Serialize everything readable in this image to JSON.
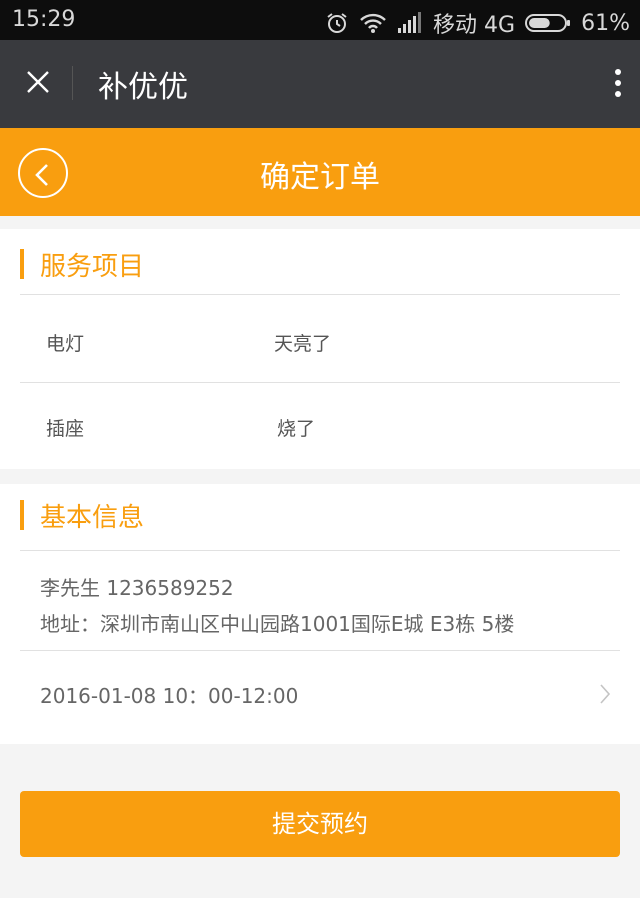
{
  "status_bar": {
    "time": "15:29",
    "carrier": "移动 4G",
    "battery": "61%",
    "battery_level": 0.61
  },
  "app_bar": {
    "title": "补优优"
  },
  "header": {
    "title": "确定订单"
  },
  "service_section": {
    "title": "服务项目",
    "items": [
      {
        "name": "电灯",
        "desc": "天亮了"
      },
      {
        "name": "插座",
        "desc": "烧了"
      }
    ]
  },
  "info_section": {
    "title": "基本信息",
    "contact": "李先生  1236589252",
    "address": "地址：深圳市南山区中山园路1001国际E城 E3栋 5楼",
    "datetime": "2016-01-08    10：00-12:00"
  },
  "submit_label": "提交预约",
  "colors": {
    "accent": "#f99e0f",
    "app_bar": "#393a3e",
    "status_bar": "#0d0d0d"
  }
}
